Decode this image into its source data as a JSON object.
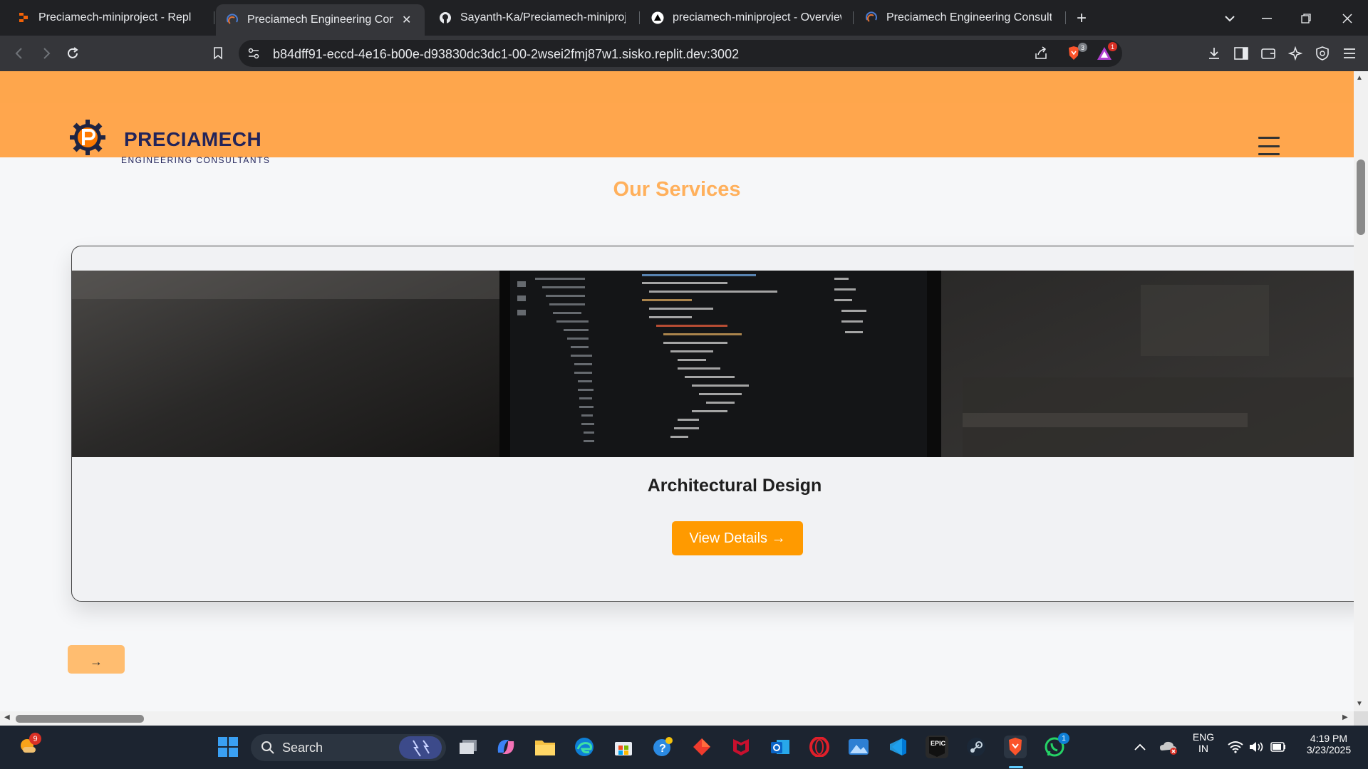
{
  "browser": {
    "tabs": [
      {
        "title": "Preciamech-miniproject - Replit",
        "icon": "replit-icon",
        "active": false
      },
      {
        "title": "Preciamech Engineering Consul",
        "icon": "preciamech-favicon-icon",
        "active": true
      },
      {
        "title": "Sayanth-Ka/Preciamech-miniproject",
        "icon": "github-icon",
        "active": false
      },
      {
        "title": "preciamech-miniproject - Overview",
        "icon": "vercel-icon",
        "active": false
      },
      {
        "title": "Preciamech Engineering Consultant",
        "icon": "preciamech-favicon-icon",
        "active": false
      }
    ],
    "url": "b84dff91-eccd-4e16-b00e-d93830dc3dc1-00-2wsei2fmj87w1.sisko.replit.dev:3002",
    "brave_shield_count": "3",
    "rewards_count": "1"
  },
  "site": {
    "brand_name": "PRECIAMECH",
    "tagline": "ENGINEERING CONSULTANTS",
    "section_title": "Our Services",
    "card": {
      "title": "Architectural Design",
      "button_label": "View Details →"
    },
    "next_label": "→",
    "colors": {
      "nav_bg": "#ffa64d",
      "accent_button": "#ff9a00",
      "section_title": "#ffb05c",
      "brand_text": "#23245a"
    }
  },
  "taskbar": {
    "weather_badge": "9",
    "search_label": "Search",
    "whatsapp_badge": "1",
    "language": "ENG",
    "region": "IN",
    "time": "4:19 PM",
    "date": "3/23/2025"
  }
}
